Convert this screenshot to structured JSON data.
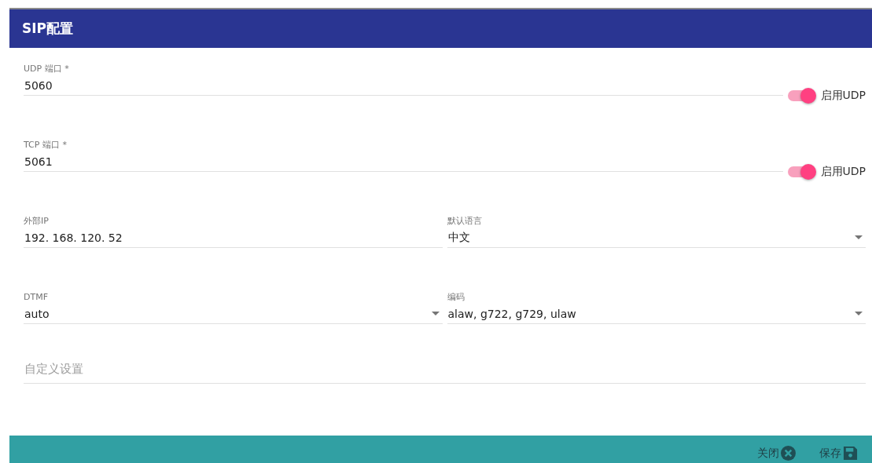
{
  "dialog": {
    "title": "SIP配置"
  },
  "rows": [
    {
      "fields": [
        {
          "kind": "text",
          "label": "UDP 端口 *",
          "value": "5060"
        }
      ],
      "toggle": {
        "label": "启用UDP",
        "on": true
      }
    },
    {
      "fields": [
        {
          "kind": "text",
          "label": "TCP 端口 *",
          "value": "5061"
        }
      ],
      "toggle": {
        "label": "启用UDP",
        "on": true
      }
    },
    {
      "fields": [
        {
          "kind": "text",
          "label": "外部IP",
          "value": "192. 168. 120. 52"
        },
        {
          "kind": "select",
          "label": "默认语言",
          "value": "中文"
        }
      ]
    },
    {
      "fields": [
        {
          "kind": "select",
          "label": "DTMF",
          "value": "auto"
        },
        {
          "kind": "select",
          "label": "编码",
          "value": "alaw, g722, g729, ulaw"
        }
      ]
    },
    {
      "fields": [
        {
          "kind": "text",
          "placeholder": "自定义设置"
        }
      ]
    }
  ],
  "buttons": [
    {
      "label": "关闭",
      "kind": "close"
    },
    {
      "label": "保存",
      "kind": "save"
    }
  ]
}
